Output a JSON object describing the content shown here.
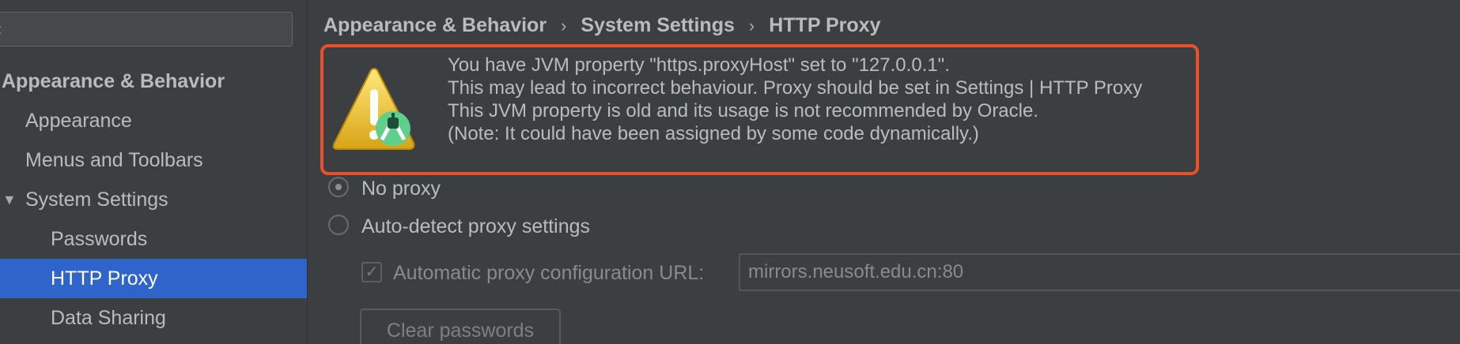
{
  "sidebar": {
    "items": [
      {
        "label": "Appearance & Behavior"
      },
      {
        "label": "Appearance"
      },
      {
        "label": "Menus and Toolbars"
      },
      {
        "label": "System Settings"
      },
      {
        "label": "Passwords"
      },
      {
        "label": "HTTP Proxy"
      },
      {
        "label": "Data Sharing"
      }
    ]
  },
  "breadcrumb": [
    "Appearance & Behavior",
    "System Settings",
    "HTTP Proxy"
  ],
  "warning": {
    "lines": [
      "You have JVM property \"https.proxyHost\" set to \"127.0.0.1\".",
      "This may lead to incorrect behaviour. Proxy should be set in Settings | HTTP Proxy",
      "This JVM property is old and its usage is not recommended by Oracle.",
      "(Note: It could have been assigned by some code dynamically.)"
    ],
    "border_color": "#e8512a",
    "icon": "warning-triangle-icon"
  },
  "proxy": {
    "no_proxy_label": "No proxy",
    "auto_detect_label": "Auto-detect proxy settings",
    "auto_config_label": "Automatic proxy configuration URL:",
    "auto_config_url": "mirrors.neusoft.edu.cn:80",
    "clear_passwords_label": "Clear passwords"
  },
  "colors": {
    "accent": "#2f65ca",
    "background": "#3c3f41",
    "text": "#bbbbbb"
  }
}
